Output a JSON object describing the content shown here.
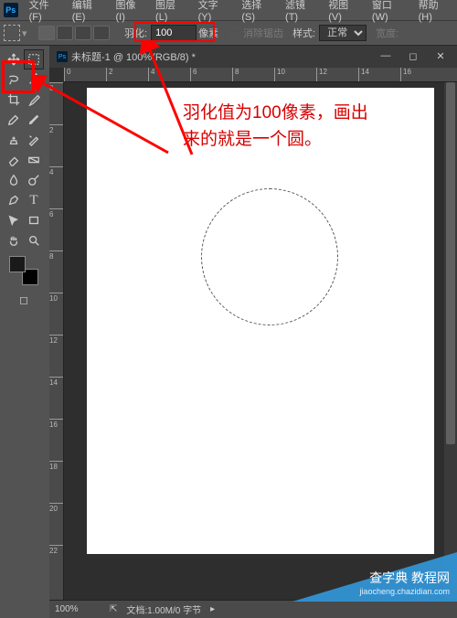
{
  "menu": [
    "文件(F)",
    "编辑(E)",
    "图像(I)",
    "图层(L)",
    "文字(Y)",
    "选择(S)",
    "滤镜(T)",
    "视图(V)",
    "窗口(W)",
    "帮助(H)"
  ],
  "options": {
    "feather_label": "羽化:",
    "feather_value": "100",
    "feather_unit": "像素",
    "antialias": "消除锯齿",
    "style_label": "样式:",
    "style_value": "正常",
    "width_label": "宽度:"
  },
  "doc": {
    "title": "未标题-1 @ 100%(RGB/8) *"
  },
  "ruler_h_labels": [
    "0",
    "2",
    "4",
    "6",
    "8",
    "10",
    "12",
    "14",
    "16"
  ],
  "ruler_v_labels": [
    "0",
    "2",
    "4",
    "6",
    "8",
    "10",
    "12",
    "14",
    "16",
    "18",
    "20",
    "22"
  ],
  "annotation": {
    "line1": "羽化值为100像素，画出",
    "line2": "来的就是一个圆。"
  },
  "status": {
    "zoom": "100%",
    "docinfo": "文档:1.00M/0 字节"
  },
  "watermark": {
    "main": "查字典 教程网",
    "sub": "jiaocheng.chazidian.com"
  }
}
